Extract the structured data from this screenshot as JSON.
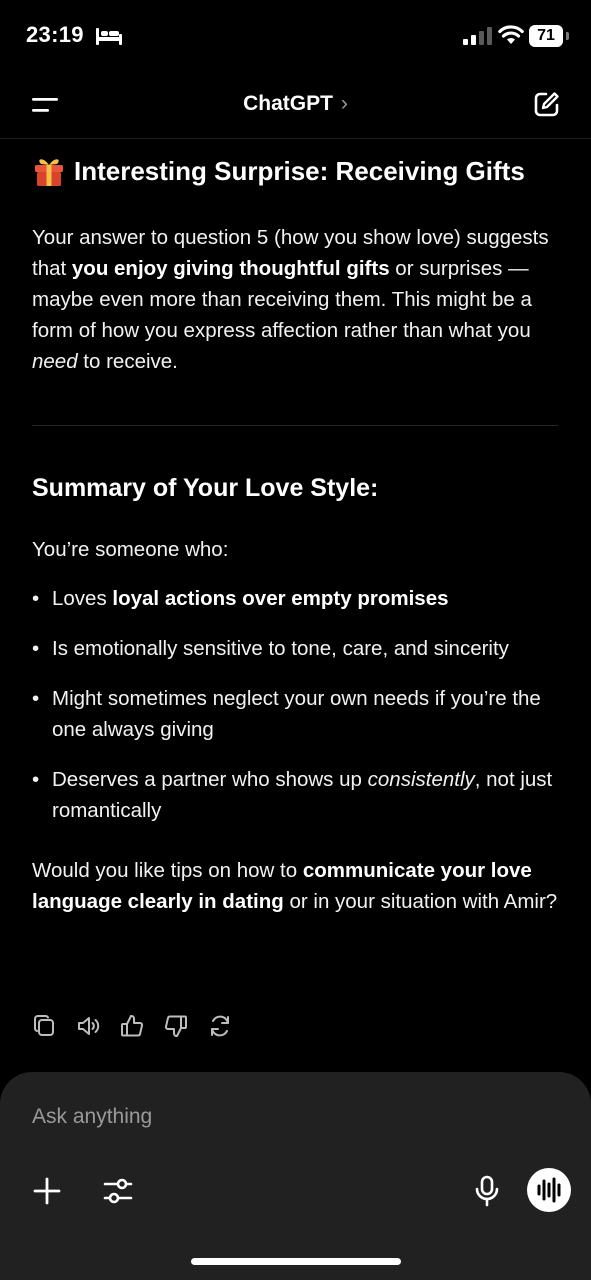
{
  "status": {
    "time": "23:19",
    "battery": "71"
  },
  "header": {
    "title": "ChatGPT",
    "chevron": "›"
  },
  "message": {
    "section_title": "Interesting Surprise: Receiving Gifts",
    "para1": {
      "a": "Your answer to question 5 (how you show love) suggests that ",
      "b_bold": "you enjoy giving thoughtful gifts",
      "c": " or surprises — maybe even more than receiving them. This might be a form of how you express affection rather than what you ",
      "d_italic": "need",
      "e": " to receive."
    },
    "summary_title": "Summary of Your Love Style:",
    "intro": "You’re someone who:",
    "bullets": [
      {
        "pre": "Loves ",
        "bold": "loyal actions over empty promises",
        "italic": "",
        "post": ""
      },
      {
        "pre": "Is emotionally sensitive to tone, care, and sincerity",
        "bold": "",
        "italic": "",
        "post": ""
      },
      {
        "pre": "Might sometimes neglect your own needs if you’re the one always giving",
        "bold": "",
        "italic": "",
        "post": ""
      },
      {
        "pre": "Deserves a partner who shows up ",
        "bold": "",
        "italic": "consistently",
        "post": ", not just romantically"
      }
    ],
    "closing": {
      "a": "Would you like tips on how to ",
      "b_bold": "communicate your love language clearly in dating",
      "c": " or in your situation with Amir?"
    }
  },
  "actions": [
    "copy-icon",
    "read-aloud-icon",
    "thumbs-up-icon",
    "thumbs-down-icon",
    "regenerate-icon"
  ],
  "composer": {
    "placeholder": "Ask anything"
  }
}
